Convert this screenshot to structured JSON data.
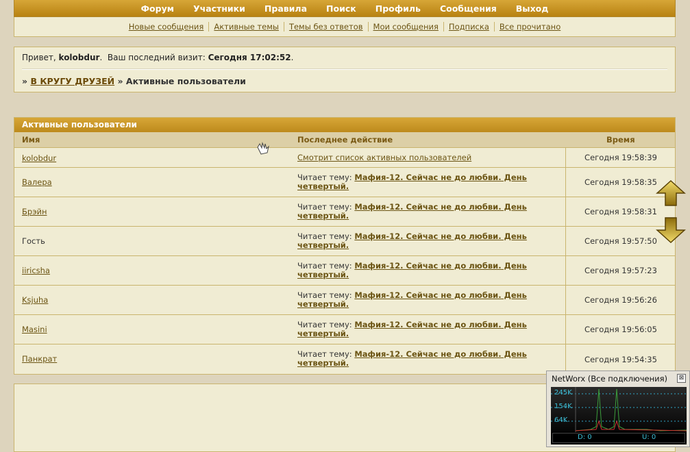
{
  "topnav": [
    "Форум",
    "Участники",
    "Правила",
    "Поиск",
    "Профиль",
    "Сообщения",
    "Выход"
  ],
  "subnav": [
    "Новые сообщения",
    "Активные темы",
    "Темы без ответов",
    "Мои сообщения",
    "Подписка",
    "Все прочитано"
  ],
  "greeting": {
    "hello": "Привет,",
    "username": "kolobdur",
    "last_visit_label": "Ваш последний визит:",
    "last_visit_value": "Сегодня 17:02:52"
  },
  "breadcrumb": {
    "sep": "»",
    "forum": "В КРУГУ ДРУЗЕЙ",
    "current": "Активные пользователи"
  },
  "table": {
    "title": "Активные пользователи",
    "col_name": "Имя",
    "col_action": "Последнее действие",
    "col_time": "Время",
    "reading_prefix": "Читает тему:",
    "rows": [
      {
        "name": "kolobdur",
        "action_link": "Смотрит список активных пользователей",
        "topic": "",
        "time": "Сегодня 19:58:39"
      },
      {
        "name": "Валера",
        "action_link": "",
        "topic": "Мафия-12. Сейчас не до любви. День четвертый.",
        "time": "Сегодня 19:58:35"
      },
      {
        "name": "Брэйн",
        "action_link": "",
        "topic": "Мафия-12. Сейчас не до любви. День четвертый.",
        "time": "Сегодня 19:58:31"
      },
      {
        "name": "Гость",
        "action_link": "",
        "topic": "Мафия-12. Сейчас не до любви. День четвертый.",
        "time": "Сегодня 19:57:50"
      },
      {
        "name": "iiricsha",
        "action_link": "",
        "topic": "Мафия-12. Сейчас не до любви. День четвертый.",
        "time": "Сегодня 19:57:23"
      },
      {
        "name": "Ksjuha",
        "action_link": "",
        "topic": "Мафия-12. Сейчас не до любви. День четвертый.",
        "time": "Сегодня 19:56:26"
      },
      {
        "name": "Masini",
        "action_link": "",
        "topic": "Мафия-12. Сейчас не до любви. День четвертый.",
        "time": "Сегодня 19:56:05"
      },
      {
        "name": "Панкрат",
        "action_link": "",
        "topic": "Мафия-12. Сейчас не до любви. День четвертый.",
        "time": "Сегодня 19:54:35"
      }
    ]
  },
  "networx": {
    "title": "NetWorx (Все подключения)",
    "close": "⊠",
    "labels": [
      "245K",
      "154K",
      "64K"
    ],
    "download": "D: 0",
    "upload": "U: 0"
  },
  "colors": {
    "accent": "#c9951f",
    "panel": "#f0ecd3",
    "link": "#6b5413",
    "graph_line": "#3ec0d8"
  }
}
